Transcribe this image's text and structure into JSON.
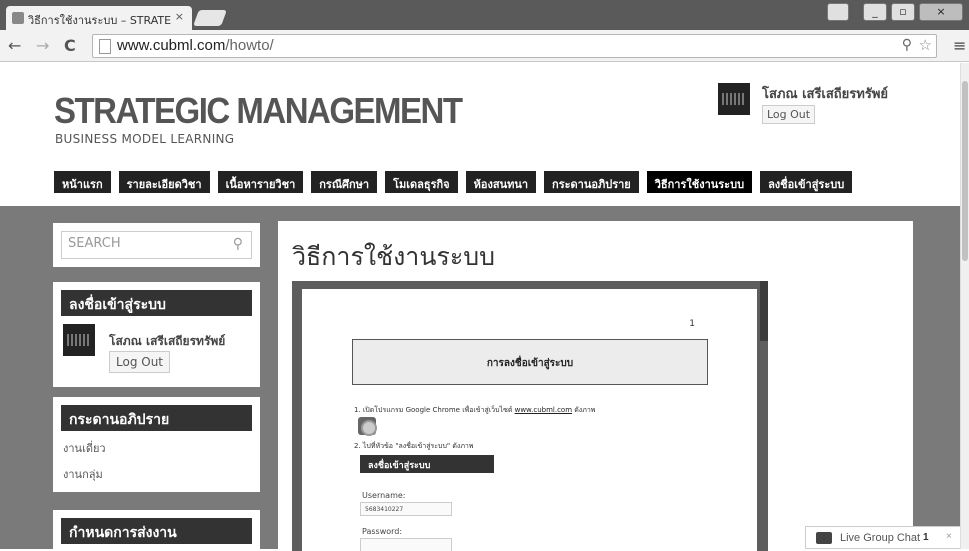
{
  "browser": {
    "tab_title": "วิธีการใช้งานระบบ – STRATE",
    "tab_close": "×",
    "url_host": "www.cubml.com",
    "url_path": "/howto/",
    "window_buttons": [
      "_",
      "▫",
      "×"
    ]
  },
  "site": {
    "title": "STRATEGIC MANAGEMENT",
    "tagline": "BUSINESS MODEL LEARNING"
  },
  "user": {
    "name": "โสภณ เสรีเสถียรทรัพย์",
    "logout": "Log Out"
  },
  "nav": {
    "items": [
      "หน้าแรก",
      "รายละเอียดวิชา",
      "เนื้อหารายวิชา",
      "กรณีศึกษา",
      "โมเดลธุรกิจ",
      "ห้องสนทนา",
      "กระดานอภิปราย",
      "วิธีการใช้งานระบบ",
      "ลงชื่อเข้าสู่ระบบ"
    ],
    "active_index": 7
  },
  "sidebar": {
    "search_placeholder": "SEARCH",
    "login_heading": "ลงชื่อเข้าสู่ระบบ",
    "login_name": "โสภณ เสรีเสถียรทรัพย์",
    "login_logout": "Log Out",
    "board_heading": "กระดานอภิปราย",
    "board_links": [
      "งานเดี่ยว",
      "งานกลุ่ม"
    ],
    "due_heading": "กำหนดการส่งงาน"
  },
  "main": {
    "heading": "วิธีการใช้งานระบบ",
    "doc": {
      "page_number": "1",
      "title": "การลงชื่อเข้าสู่ระบบ",
      "step1_prefix": "1. เปิดโปรแกรม Google Chrome เพื่อเข้าสู่เว็บไซต์ ",
      "step1_link": "www.cubml.com",
      "step1_suffix": " ดังภาพ",
      "step2": "2. ไปที่หัวข้อ \"ลงชื่อเข้าสู่ระบบ\" ดังภาพ",
      "mini_heading": "ลงชื่อเข้าสู่ระบบ",
      "username_label": "Username:",
      "username_value": "5683410227",
      "password_label": "Password:"
    }
  },
  "chat": {
    "label": "Live Group Chat",
    "count": "1",
    "close": "×"
  }
}
